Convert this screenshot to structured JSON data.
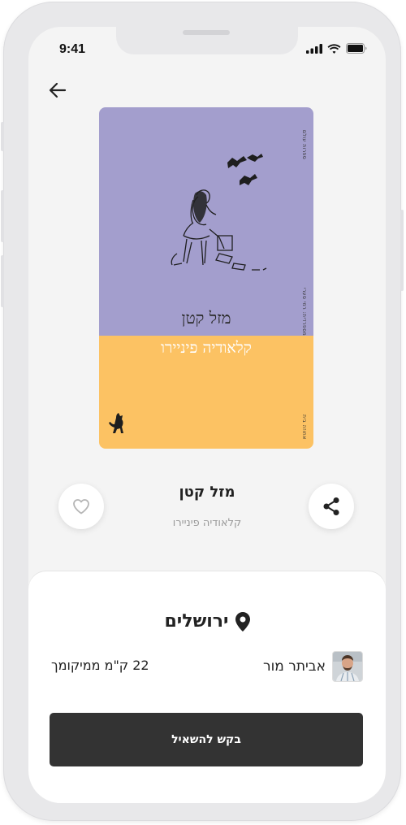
{
  "status_bar": {
    "time": "9:41"
  },
  "cover": {
    "title": "מזל קטן",
    "author": "קלאודיה פיניירו",
    "series_text": "ספרות עולם",
    "side_text": "מספרדית: רמי סערי",
    "publisher_text": "אחוזה בית",
    "colors": {
      "top": "#a39ecd",
      "bottom": "#fcc263"
    }
  },
  "book": {
    "title": "מזל קטן",
    "author": "קלאודיה פיניירו"
  },
  "details": {
    "location": "ירושלים",
    "owner_name": "אביתר מור",
    "distance": "22 ק\"מ ממיקומך",
    "request_label": "בקש להשאיל"
  },
  "icons": {
    "back": "arrow-left-icon",
    "like": "heart-icon",
    "share": "share-icon",
    "location": "map-pin-icon"
  }
}
